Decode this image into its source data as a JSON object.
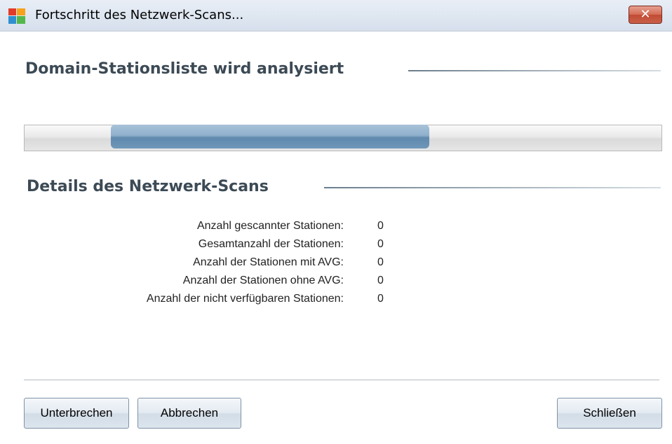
{
  "window": {
    "title": "Fortschritt des Netzwerk-Scans...",
    "close_symbol": "✕",
    "icon": "avg-logo-icon"
  },
  "analysis": {
    "heading": "Domain-Stationsliste wird analysiert"
  },
  "progress": {
    "state": "indeterminate",
    "fill_start_fraction": 0.136,
    "fill_end_fraction": 0.635
  },
  "details": {
    "heading": "Details des Netzwerk-Scans",
    "stats": [
      {
        "label": "Anzahl gescannter Stationen:",
        "value": "0"
      },
      {
        "label": "Gesamtanzahl der Stationen:",
        "value": "0"
      },
      {
        "label": "Anzahl der Stationen mit AVG:",
        "value": "0"
      },
      {
        "label": "Anzahl der Stationen ohne AVG:",
        "value": "0"
      },
      {
        "label": "Anzahl der nicht verfügbaren Stationen:",
        "value": "0"
      }
    ]
  },
  "buttons": {
    "pause": "Unterbrechen",
    "cancel": "Abbrechen",
    "close": "Schließen"
  },
  "colors": {
    "progress_fill": "#6f97b9",
    "heading_text": "#3c4a55",
    "close_button": "#c9604a"
  }
}
